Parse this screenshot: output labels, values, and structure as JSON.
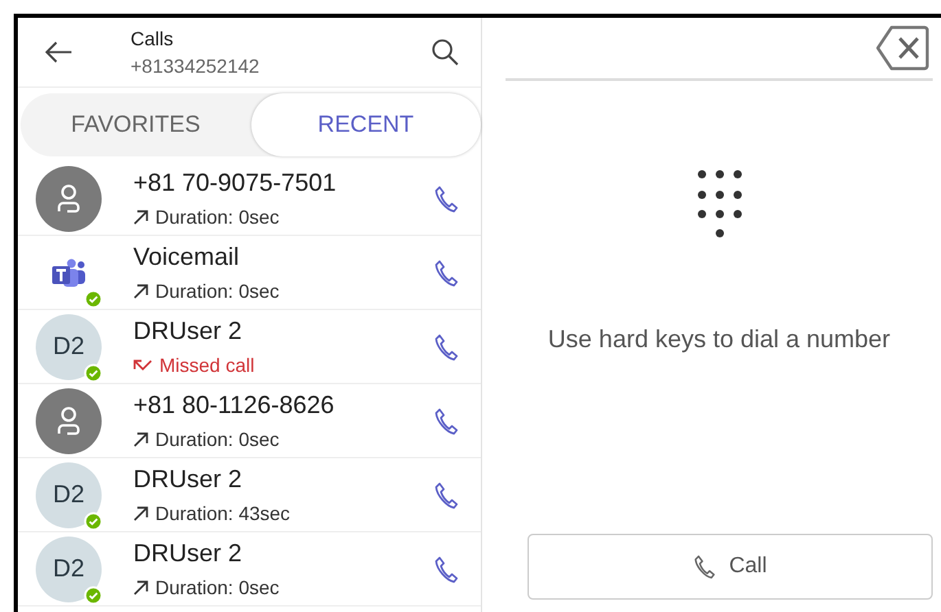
{
  "header": {
    "title": "Calls",
    "subtitle": "+81334252142"
  },
  "tabs": [
    {
      "label": "FAVORITES",
      "selected": false
    },
    {
      "label": "RECENT",
      "selected": true
    }
  ],
  "calls": [
    {
      "name": "+81 70-9075-7501",
      "avatar": {
        "kind": "person"
      },
      "online": false,
      "kind": "outgoing",
      "detail": "Duration: 0sec"
    },
    {
      "name": "Voicemail",
      "avatar": {
        "kind": "teams"
      },
      "online": true,
      "kind": "outgoing",
      "detail": "Duration: 0sec"
    },
    {
      "name": "DRUser 2",
      "avatar": {
        "kind": "initials",
        "initials": "D2"
      },
      "online": true,
      "kind": "missed",
      "detail": "Missed call"
    },
    {
      "name": "+81 80-1126-8626",
      "avatar": {
        "kind": "person"
      },
      "online": false,
      "kind": "outgoing",
      "detail": "Duration: 0sec"
    },
    {
      "name": "DRUser 2",
      "avatar": {
        "kind": "initials",
        "initials": "D2"
      },
      "online": true,
      "kind": "outgoing",
      "detail": "Duration: 43sec"
    },
    {
      "name": "DRUser 2",
      "avatar": {
        "kind": "initials",
        "initials": "D2"
      },
      "online": true,
      "kind": "outgoing",
      "detail": "Duration: 0sec"
    }
  ],
  "dialpad": {
    "hint": "Use hard keys to dial a number",
    "call_button": "Call"
  }
}
